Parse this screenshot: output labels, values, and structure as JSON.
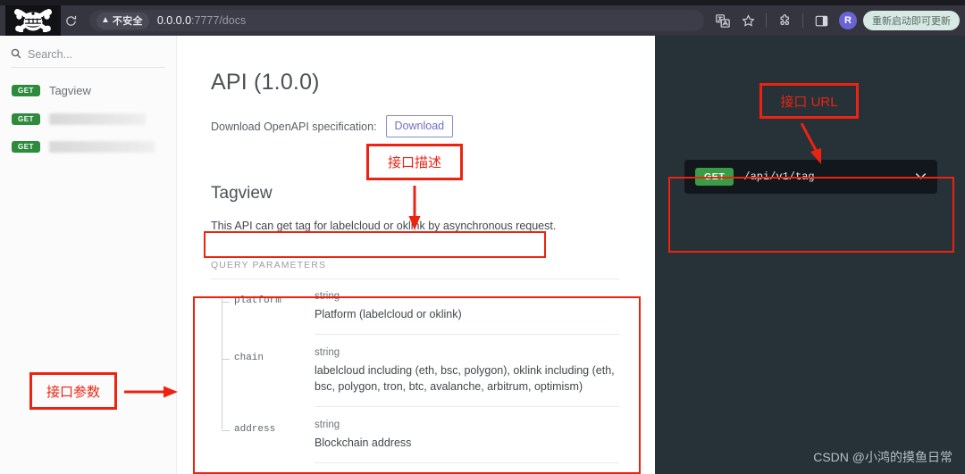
{
  "browser": {
    "logo_icon": "skull-crossbones-logo",
    "reload_icon": "reload-icon",
    "security_badge": {
      "icon": "warning-triangle-icon",
      "label": "不安全"
    },
    "url": {
      "host": "0.0.0.0",
      "rest": ":7777/docs"
    },
    "toolbar_icons": [
      "translate-icon",
      "star-bookmark-icon",
      "extensions-puzzle-icon",
      "side-panel-icon"
    ],
    "avatar_initial": "R",
    "update_button_label": "重新启动即可更新"
  },
  "sidebar": {
    "search_placeholder": "Search...",
    "search_value": "",
    "search_icon": "search-icon",
    "items": [
      {
        "method": "GET",
        "label": "Tagview",
        "redacted": false
      },
      {
        "method": "GET",
        "label": "",
        "redacted": true
      },
      {
        "method": "GET",
        "label": "",
        "redacted": true
      }
    ]
  },
  "content": {
    "api_title": "API (1.0.0)",
    "spec_label": "Download OpenAPI specification:",
    "download_label": "Download",
    "tag_title": "Tagview",
    "tag_description": "This API can get tag for labelcloud or oklink by asynchronous request.",
    "section_label": "QUERY PARAMETERS",
    "parameters": [
      {
        "name": "platform",
        "type": "string",
        "description": "Platform (labelcloud or oklink)"
      },
      {
        "name": "chain",
        "type": "string",
        "description": "labelcloud including (eth, bsc, polygon), oklink including (eth, bsc, polygon, tron, btc, avalanche, arbitrum, optimism)"
      },
      {
        "name": "address",
        "type": "string",
        "description": "Blockchain address"
      }
    ]
  },
  "right_panel": {
    "endpoint_method": "GET",
    "endpoint_path": "/api/v1/tag",
    "chevron_icon": "chevron-down-icon",
    "watermark": "CSDN @小鸿的摸鱼日常"
  },
  "annotations": {
    "accent_color": "#ee2211",
    "description_label": "接口描述",
    "parameters_label": "接口参数",
    "url_label": "接口 URL"
  }
}
